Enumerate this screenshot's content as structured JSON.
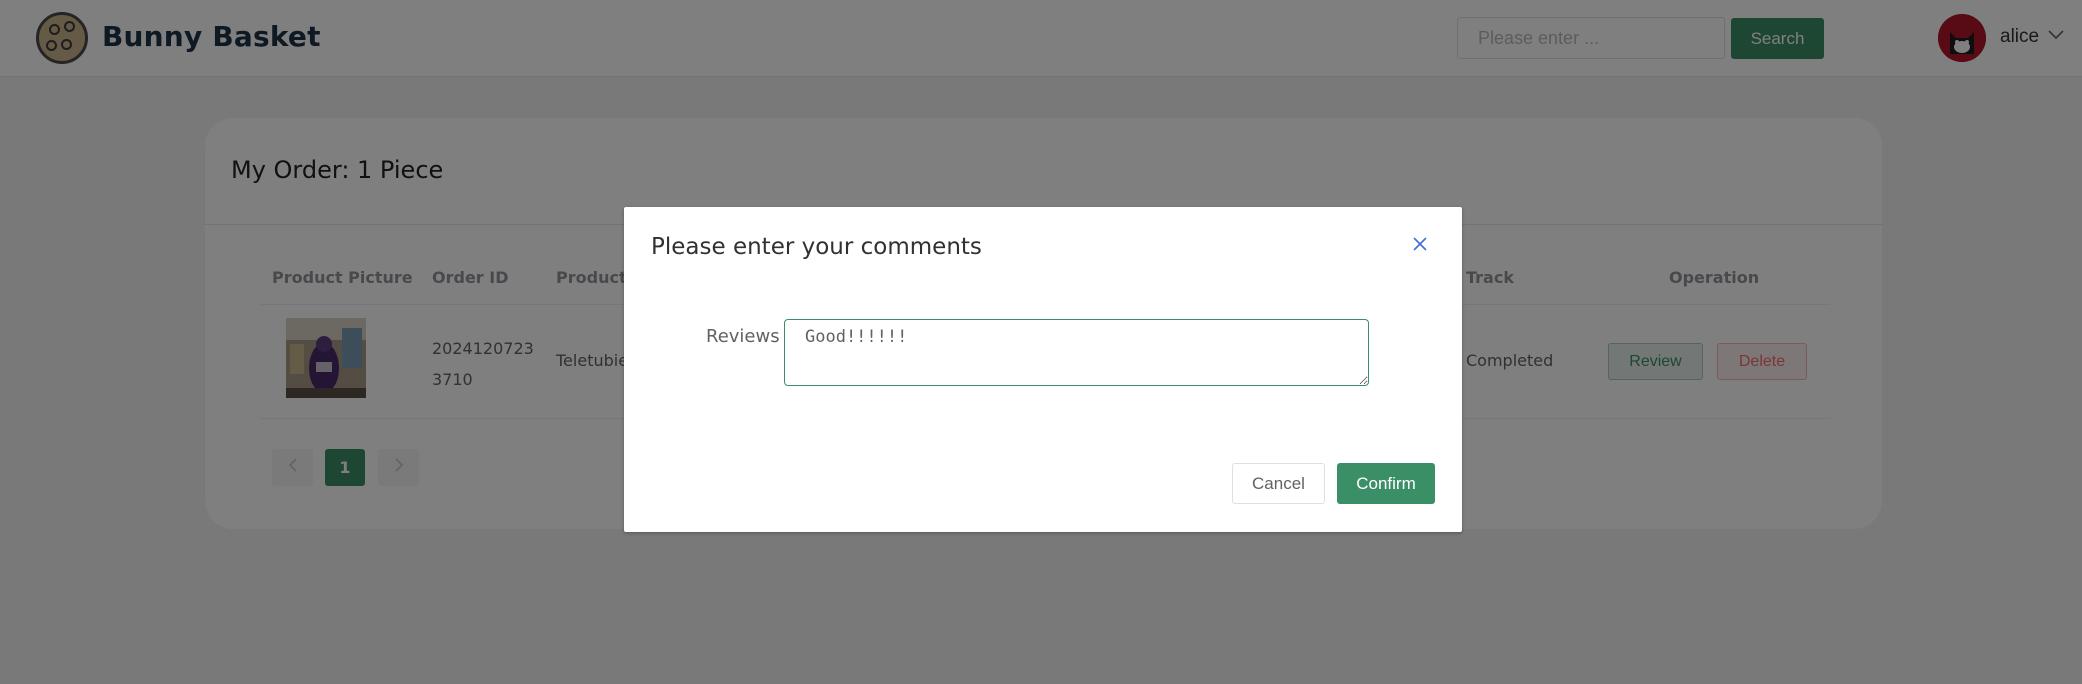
{
  "header": {
    "brand": "Bunny Basket",
    "search_placeholder": "Please enter ...",
    "search_label": "Search",
    "username": "alice"
  },
  "orders": {
    "title": "My Order: 1 Piece",
    "columns": [
      "Product Picture",
      "Order ID",
      "Product",
      "Track",
      "Operation"
    ],
    "rows": [
      {
        "order_id_line1": "2024120723",
        "order_id_line2": "3710",
        "product": "Teletubies",
        "track": "Completed",
        "review_label": "Review",
        "delete_label": "Delete"
      }
    ],
    "pagination": {
      "current_page": "1",
      "prev_icon": "chevron-left-icon",
      "next_icon": "chevron-right-icon"
    }
  },
  "dialog": {
    "title": "Please enter your comments",
    "field_label": "Reviews",
    "field_value": "Good!!!!!!",
    "cancel_label": "Cancel",
    "confirm_label": "Confirm"
  },
  "colors": {
    "primary": "#3b8f66",
    "danger": "#f56c6c",
    "brand_text": "#1f3347",
    "overlay": "rgba(0,0,0,0.5)"
  }
}
